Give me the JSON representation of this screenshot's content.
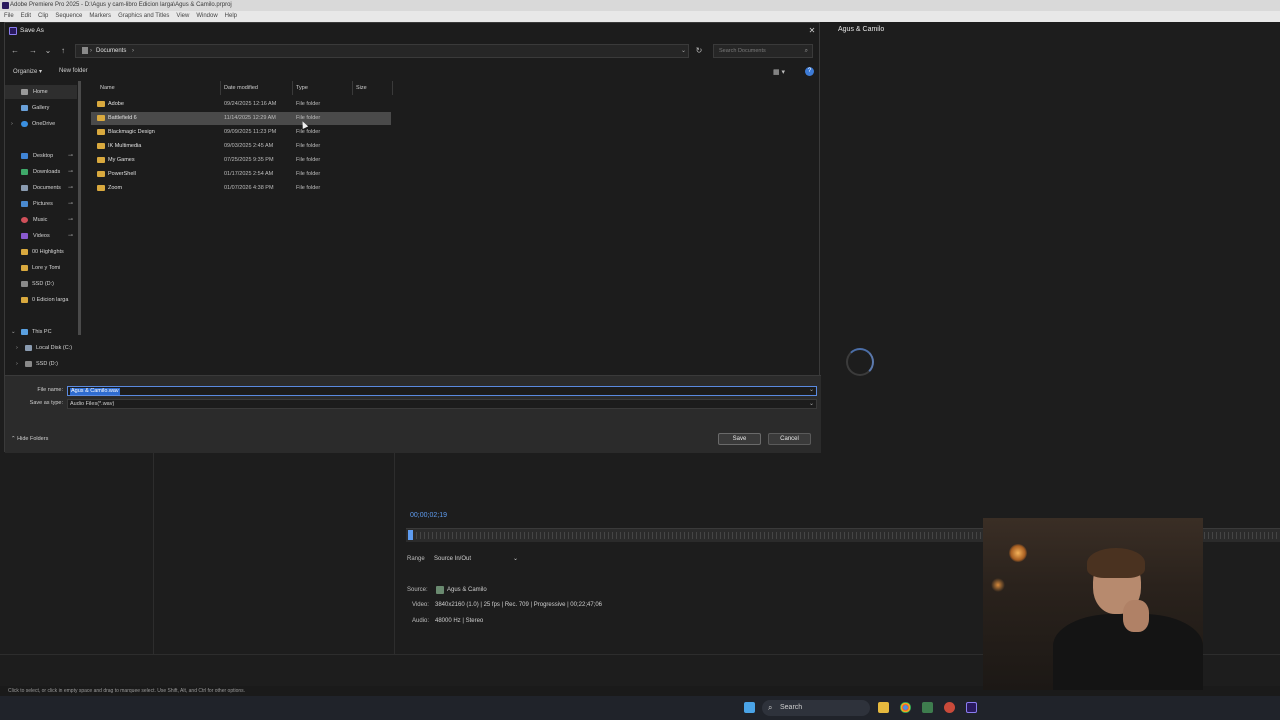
{
  "app": {
    "window_title": "Adobe Premiere Pro 2025 - D:\\Agus y cam-libro Edicion larga\\Agus & Camilo.prproj",
    "menu": [
      "File",
      "Edit",
      "Clip",
      "Sequence",
      "Markers",
      "Graphics and Titles",
      "View",
      "Window",
      "Help"
    ],
    "export_title": "Agus & Camilo",
    "timecode": "00;00;02;19",
    "range_label": "Range",
    "range_value": "Source In/Out",
    "source_label": "Source:",
    "source_name": "Agus & Camilo",
    "video_label": "Video:",
    "video_info": "3840x2160 (1.0)  |  25 fps  |  Rec. 709  |  Progressive  |  00;22;47;06",
    "audio_label": "Audio:",
    "audio_info": "48000 Hz  |  Stereo",
    "status_text": "Click to select, or click in empty space and drag to marquee select. Use Shift, Alt, and Ctrl for other options."
  },
  "taskbar": {
    "search_placeholder": "Search"
  },
  "dialog": {
    "title": "Save As",
    "close_glyph": "✕",
    "address": {
      "location": "Documents",
      "separator": "›"
    },
    "search_placeholder": "Search Documents",
    "toolbar": {
      "organize": "Organize ▾",
      "new_folder": "New folder"
    },
    "nav_items": [
      {
        "label": "Home",
        "selected": true
      },
      {
        "label": "Gallery"
      },
      {
        "label": "OneDrive"
      },
      {
        "label": "Desktop"
      },
      {
        "label": "Downloads"
      },
      {
        "label": "Documents"
      },
      {
        "label": "Pictures"
      },
      {
        "label": "Music"
      },
      {
        "label": "Videos"
      },
      {
        "label": "00 Highlights"
      },
      {
        "label": "Lore y Tomi"
      },
      {
        "label": "SSD (D:)"
      },
      {
        "label": "0 Edicion larga"
      },
      {
        "label": "This PC"
      },
      {
        "label": "Local Disk (C:)"
      },
      {
        "label": "SSD (D:)"
      }
    ],
    "columns": [
      "Name",
      "Date modified",
      "Type",
      "Size"
    ],
    "files": [
      {
        "name": "Adobe",
        "date": "09/24/2025 12:16 AM",
        "type": "File folder"
      },
      {
        "name": "Battlefield 6",
        "date": "11/14/2025 12:29 AM",
        "type": "File folder",
        "selected": true
      },
      {
        "name": "Blackmagic Design",
        "date": "09/09/2025 11:23 PM",
        "type": "File folder"
      },
      {
        "name": "IK Multimedia",
        "date": "09/03/2025 2:45 AM",
        "type": "File folder"
      },
      {
        "name": "My Games",
        "date": "07/25/2025 9:35 PM",
        "type": "File folder"
      },
      {
        "name": "PowerShell",
        "date": "01/17/2025 2:54 AM",
        "type": "File folder"
      },
      {
        "name": "Zoom",
        "date": "01/07/2026 4:38 PM",
        "type": "File folder"
      }
    ],
    "file_name_label": "File name:",
    "file_name_value": "Agus & Camilo.wav",
    "save_type_label": "Save as type:",
    "save_type_value": "Audio Files(*.wav)",
    "hide_folders": "Hide Folders",
    "save_button": "Save",
    "cancel_button": "Cancel"
  },
  "colors": {
    "accent": "#5e9cf0",
    "selection": "#2f6cd0",
    "folder": "#d9a93e"
  }
}
